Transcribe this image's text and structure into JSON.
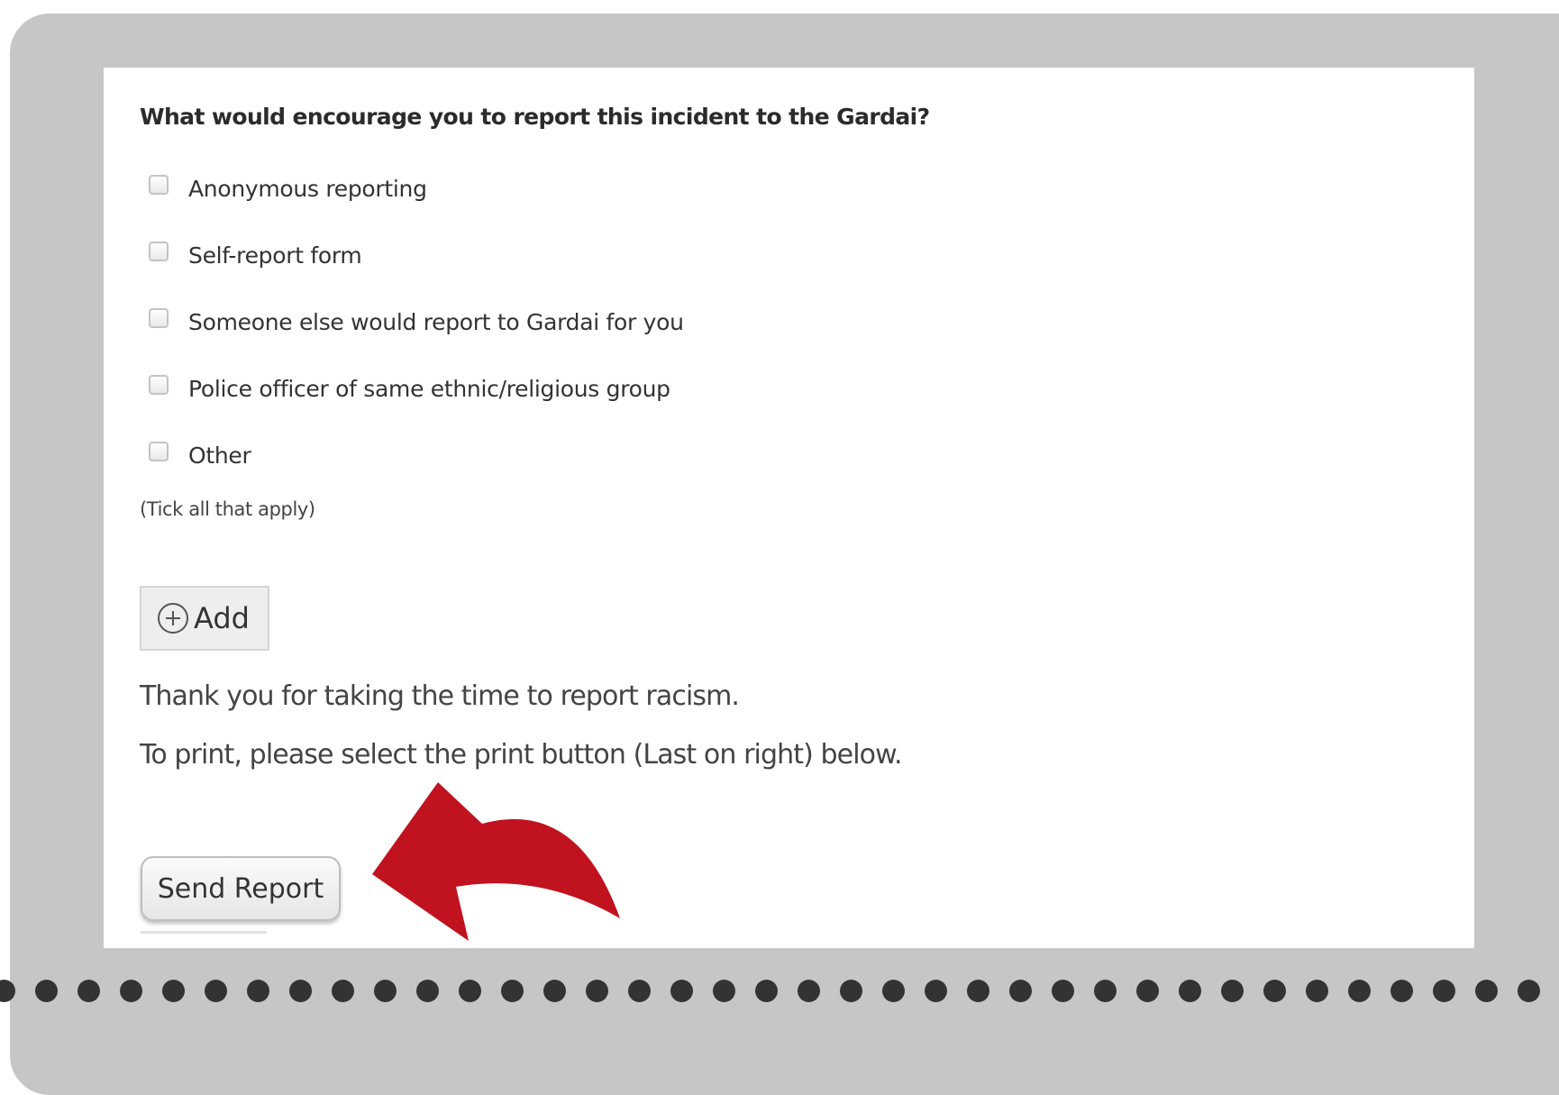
{
  "form": {
    "question": "What would encourage you to report this incident to the Gardai?",
    "options": [
      {
        "label": "Anonymous reporting",
        "checked": false
      },
      {
        "label": "Self-report form",
        "checked": false
      },
      {
        "label": "Someone else would report to Gardai for you",
        "checked": false
      },
      {
        "label": "Police officer of same ethnic/religious group",
        "checked": false
      },
      {
        "label": "Other",
        "checked": false
      }
    ],
    "hint": "(Tick all that apply)",
    "add_label": "Add",
    "add_icon": "plus-circle-icon",
    "thank_you": "Thank you for taking the time to report racism.",
    "print_instruction": "To print, please select the print button (Last on right) below.",
    "send_label": "Send Report"
  },
  "annotation": {
    "arrow_icon": "curved-arrow-icon",
    "arrow_color": "#c1121f"
  },
  "colors": {
    "frame": "#c6c6c6",
    "panel": "#ffffff",
    "dots": "#333333"
  }
}
